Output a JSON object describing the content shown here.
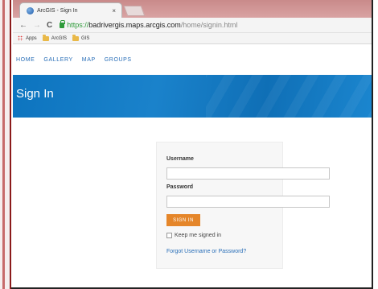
{
  "browser": {
    "tab_title": "ArcGIS - Sign In",
    "tab_close": "×",
    "nav_back": "←",
    "nav_forward": "→",
    "nav_reload": "C",
    "url_scheme": "https://",
    "url_host": "badrivergis.maps.arcgis.com",
    "url_path": "/home/signin.html",
    "bookmarks": [
      {
        "label": "Apps",
        "icon": "apps-icon"
      },
      {
        "label": "ArcGIS",
        "icon": "folder-icon"
      },
      {
        "label": "GIS",
        "icon": "folder-icon"
      }
    ]
  },
  "site_nav": {
    "items": [
      "HOME",
      "GALLERY",
      "MAP",
      "GROUPS"
    ]
  },
  "header": {
    "title": "Sign In",
    "color": "#0d74bf"
  },
  "signin_form": {
    "username_label": "Username",
    "username_value": "",
    "password_label": "Password",
    "password_value": "",
    "submit_label": "SIGN IN",
    "submit_color": "#e5862a",
    "keep_signed_in_label": "Keep me signed in",
    "keep_signed_in_checked": false,
    "forgot_link": "Forgot Username or Password?"
  }
}
